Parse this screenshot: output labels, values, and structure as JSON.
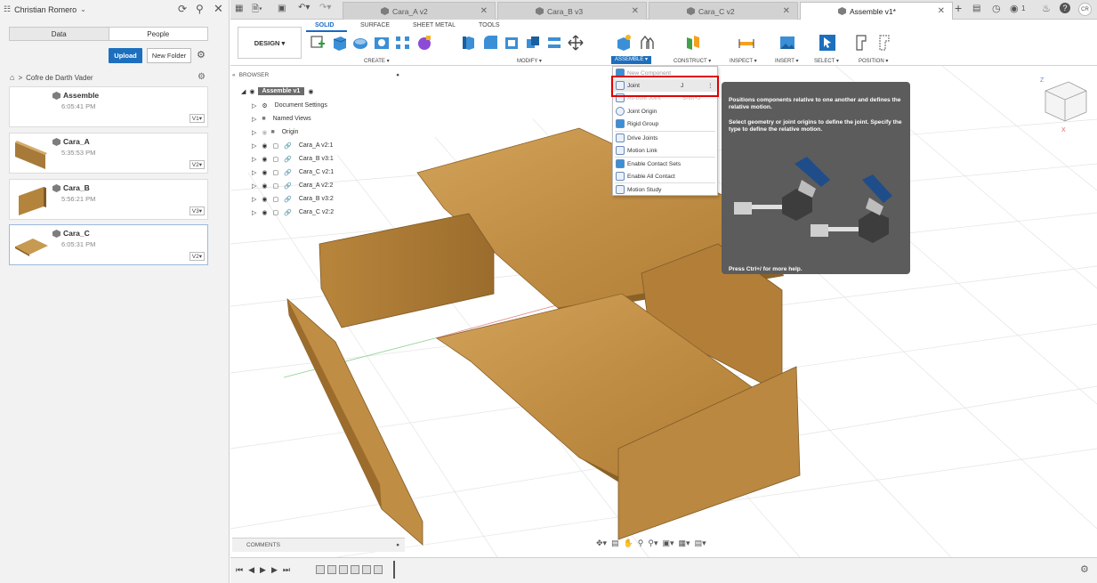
{
  "top": {
    "user": "Christian Romero",
    "tabs": [
      "Cara_A v2",
      "Cara_B v3",
      "Cara_C v2",
      "Assemble v1*"
    ],
    "notifications": "1",
    "avatar": "CR"
  },
  "left": {
    "tabs": [
      "Data",
      "People"
    ],
    "upload": "Upload",
    "new_folder": "New Folder",
    "breadcrumb": "Cofre de Darth Vader",
    "files": [
      {
        "name": "Assemble",
        "time": "6:05:41 PM",
        "version": "V1"
      },
      {
        "name": "Cara_A",
        "time": "5:35:53 PM",
        "version": "V2"
      },
      {
        "name": "Cara_B",
        "time": "5:56:21 PM",
        "version": "V3"
      },
      {
        "name": "Cara_C",
        "time": "6:05:31 PM",
        "version": "V2"
      }
    ]
  },
  "toolbar": {
    "design": "DESIGN",
    "tabs": [
      "SOLID",
      "SURFACE",
      "SHEET METAL",
      "TOOLS"
    ],
    "groups": [
      "CREATE",
      "MODIFY",
      "ASSEMBLE",
      "CONSTRUCT",
      "INSPECT",
      "INSERT",
      "SELECT",
      "POSITION"
    ]
  },
  "browser": {
    "title": "BROWSER",
    "root": "Assemble v1",
    "items": [
      "Document Settings",
      "Named Views",
      "Origin",
      "Cara_A v2:1",
      "Cara_B v3:1",
      "Cara_C v2:1",
      "Cara_A v2:2",
      "Cara_B v3:2",
      "Cara_C v2:2"
    ]
  },
  "menu": {
    "items": [
      "New Component",
      "Joint",
      "As-built Joint",
      "Joint Origin",
      "Rigid Group",
      "Drive Joints",
      "Motion Link",
      "Enable Contact Sets",
      "Enable All Contact",
      "Motion Study"
    ],
    "joint_shortcut": "J",
    "asbuilt_shortcut": "Shift+J"
  },
  "tooltip": {
    "line1": "Positions components relative to one another and defines the relative motion.",
    "line2": "Select geometry or joint origins to define the joint. Specify the type to define the relative motion.",
    "help": "Press Ctrl+/ for more help."
  },
  "comments": "COMMENTS",
  "colors": {
    "accent": "#1d6fbe",
    "highlight": "#e00000",
    "wood": "#b9893f"
  }
}
